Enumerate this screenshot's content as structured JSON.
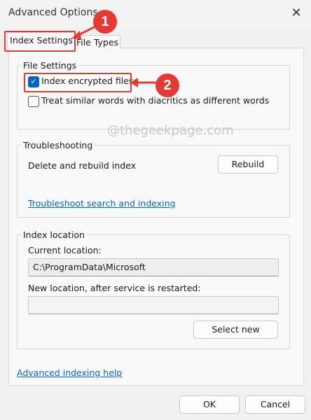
{
  "window": {
    "title": "Advanced Options",
    "close_glyph": "✕"
  },
  "tabs": [
    {
      "label": "Index Settings",
      "active": true
    },
    {
      "label": "File Types",
      "active": false
    }
  ],
  "callouts": {
    "one": "1",
    "two": "2",
    "color": "#e53935"
  },
  "file_settings": {
    "legend": "File Settings",
    "index_encrypted": {
      "label": "Index encrypted files",
      "checked": true
    },
    "treat_similar": {
      "label": "Treat similar words with diacritics as different words",
      "checked": false
    }
  },
  "watermark": "@thegeekpage.com",
  "troubleshooting": {
    "legend": "Troubleshooting",
    "delete_label": "Delete and rebuild index",
    "rebuild_button": "Rebuild",
    "link": "Troubleshoot search and indexing"
  },
  "index_location": {
    "legend": "Index location",
    "current_label": "Current location:",
    "current_value": "C:\\ProgramData\\Microsoft",
    "new_label": "New location, after service is restarted:",
    "new_value": "",
    "select_button": "Select new"
  },
  "advanced_help_link": "Advanced indexing help",
  "footer": {
    "ok": "OK",
    "cancel": "Cancel"
  },
  "colors": {
    "accent": "#0067c0",
    "link": "#0066cc",
    "highlight": "#e53935"
  }
}
